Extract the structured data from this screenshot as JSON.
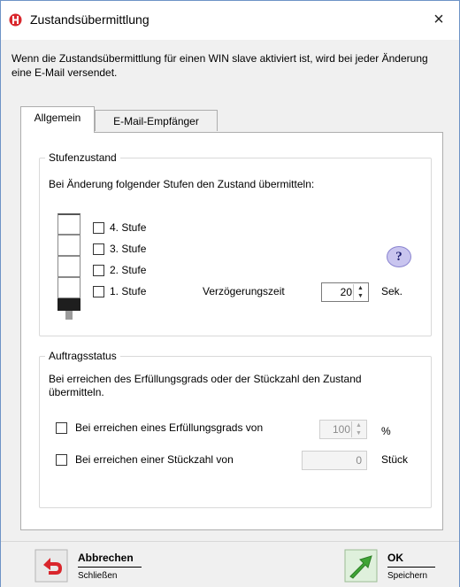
{
  "window": {
    "title": "Zustandsübermittlung",
    "close_symbol": "×",
    "description": "Wenn die Zustandsübermittlung für einen WIN slave aktiviert ist, wird bei jeder Änderung eine E-Mail versendet."
  },
  "tabs": [
    {
      "label": "Allgemein",
      "active": true
    },
    {
      "label": "E-Mail-Empfänger",
      "active": false
    }
  ],
  "stufenzustand": {
    "legend": "Stufenzustand",
    "instruction": "Bei Änderung folgender Stufen den Zustand übermitteln:",
    "stufen": [
      {
        "label": "4. Stufe",
        "checked": false
      },
      {
        "label": "3. Stufe",
        "checked": false
      },
      {
        "label": "2. Stufe",
        "checked": false
      },
      {
        "label": "1. Stufe",
        "checked": false
      }
    ],
    "delay_label": "Verzögerungszeit",
    "delay_value": "20",
    "delay_unit": "Sek.",
    "help_symbol": "?"
  },
  "auftragsstatus": {
    "legend": "Auftragsstatus",
    "instruction": "Bei erreichen des Erfüllungsgrads oder der Stückzahl den Zustand übermitteln.",
    "erfuellungsgrad_label": "Bei erreichen eines Erfüllungsgrads von",
    "erfuellungsgrad_value": "100",
    "erfuellungsgrad_unit": "%",
    "stueckzahl_label": "Bei erreichen einer Stückzahl von",
    "stueckzahl_value": "0",
    "stueckzahl_unit": "Stück"
  },
  "buttons": {
    "cancel_title": "Abbrechen",
    "cancel_sub": "Schließen",
    "ok_title": "OK",
    "ok_sub": "Speichern"
  },
  "icons": {
    "app": "signal-tower-logo-icon",
    "cancel": "undo-arrow-icon",
    "ok": "checkmark-arrow-icon",
    "help": "help-icon"
  },
  "colors": {
    "accent_red": "#d9262c",
    "ok_green": "#3fa535",
    "help_bg": "#c9c5ef"
  }
}
